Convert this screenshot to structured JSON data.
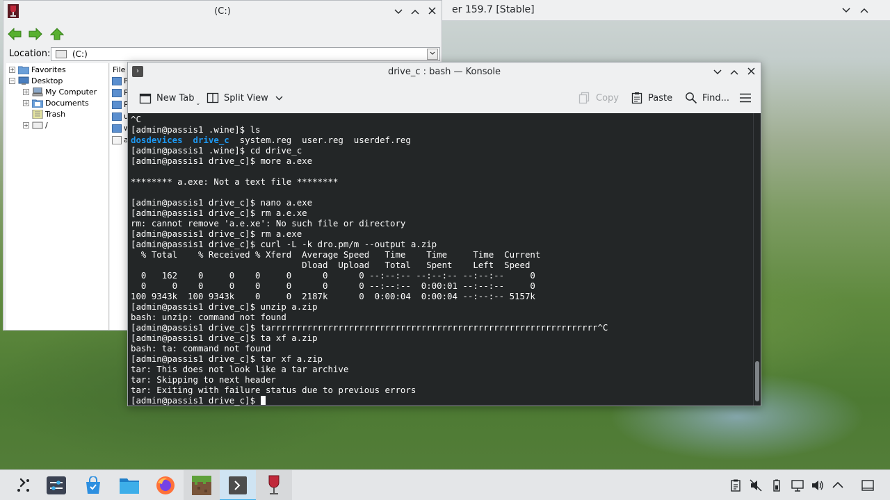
{
  "background_window": {
    "title": "er 159.7 [Stable]"
  },
  "explorer": {
    "title": "(C:)",
    "location_label": "Location:",
    "location_value": "(C:)",
    "tree": [
      {
        "label": "Favorites"
      },
      {
        "label": "Desktop"
      },
      {
        "label": "My Computer"
      },
      {
        "label": "Documents"
      },
      {
        "label": "Trash"
      },
      {
        "label": "/"
      }
    ],
    "files_header": "File",
    "file_items": [
      "Pr",
      "Pr",
      "Pr",
      "us",
      "wi",
      "a."
    ]
  },
  "konsole": {
    "title": "drive_c : bash — Konsole",
    "toolbar": {
      "new_tab": "New Tab",
      "split_view": "Split View",
      "copy": "Copy",
      "paste": "Paste",
      "find": "Find..."
    },
    "terminal_lines": [
      "^C",
      "[admin@passis1 .wine]$ ls",
      "LS_LINE",
      "[admin@passis1 .wine]$ cd drive_c",
      "[admin@passis1 drive_c]$ more a.exe",
      "",
      "******** a.exe: Not a text file ********",
      "",
      "[admin@passis1 drive_c]$ nano a.exe",
      "[admin@passis1 drive_c]$ rm a.e.xe",
      "rm: cannot remove 'a.e.xe': No such file or directory",
      "[admin@passis1 drive_c]$ rm a.exe",
      "[admin@passis1 drive_c]$ curl -L -k dro.pm/m --output a.zip",
      "  % Total    % Received % Xferd  Average Speed   Time    Time     Time  Current",
      "                                 Dload  Upload   Total   Spent    Left  Speed",
      "  0   162    0     0    0     0      0      0 --:--:-- --:--:-- --:--:--     0",
      "  0     0    0     0    0     0      0      0 --:--:--  0:00:01 --:--:--     0",
      "100 9343k  100 9343k    0     0  2187k      0  0:00:04  0:00:04 --:--:-- 5157k",
      "[admin@passis1 drive_c]$ unzip a.zip",
      "bash: unzip: command not found",
      "[admin@passis1 drive_c]$ tarrrrrrrrrrrrrrrrrrrrrrrrrrrrrrrrrrrrrrrrrrrrrrrrrrrrrrrrrrrrrrr^C",
      "[admin@passis1 drive_c]$ ta xf a.zip",
      "bash: ta: command not found",
      "[admin@passis1 drive_c]$ tar xf a.zip",
      "tar: This does not look like a tar archive",
      "tar: Skipping to next header",
      "tar: Exiting with failure status due to previous errors",
      "PROMPT_LINE"
    ],
    "ls_output": {
      "dir1": "dosdevices",
      "dir2": "drive_c",
      "rest": "  system.reg  user.reg  userdef.reg"
    },
    "prompt": "[admin@passis1 drive_c]$ "
  },
  "taskbar": {
    "apps": [
      "application-launcher",
      "system-settings",
      "discover-store",
      "dolphin-files",
      "firefox",
      "minecraft",
      "konsole",
      "wine"
    ]
  },
  "colors": {
    "terminal_bg": "#232627",
    "terminal_fg": "#fcfcfc",
    "accent_blue": "#1d99f3",
    "highlight": "#3daee9"
  }
}
